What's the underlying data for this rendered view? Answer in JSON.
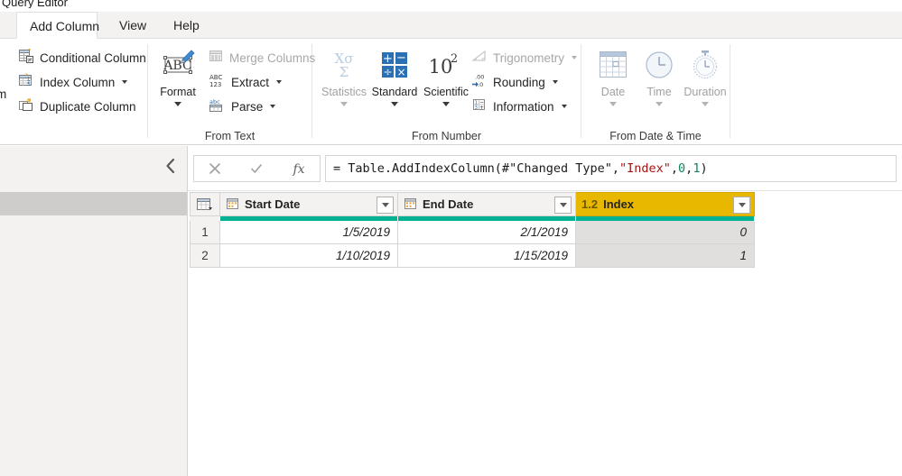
{
  "window": {
    "title": "Query Editor"
  },
  "tabs": [
    {
      "label": "Add Column",
      "active": true
    },
    {
      "label": "View",
      "active": false
    },
    {
      "label": "Help",
      "active": false
    }
  ],
  "ribbon": {
    "clipped_left_fragment": "m",
    "groups": [
      {
        "name": "general",
        "label": "",
        "items": [
          {
            "label": "Conditional Column",
            "icon": "conditional-column-icon",
            "enabled": true,
            "has_caret": false
          },
          {
            "label": "Index Column",
            "icon": "index-column-icon",
            "enabled": true,
            "has_caret": true
          },
          {
            "label": "Duplicate Column",
            "icon": "duplicate-column-icon",
            "enabled": true,
            "has_caret": false
          }
        ]
      },
      {
        "name": "from-text",
        "label": "From Text",
        "big_items": [
          {
            "label": "Format",
            "icon": "format-abc-pencil-icon",
            "enabled": true,
            "has_caret": true
          }
        ],
        "items": [
          {
            "label": "Merge Columns",
            "icon": "merge-columns-icon",
            "enabled": false,
            "has_caret": false
          },
          {
            "label": "Extract",
            "icon": "extract-abc123-icon",
            "enabled": true,
            "has_caret": true
          },
          {
            "label": "Parse",
            "icon": "parse-icon",
            "enabled": true,
            "has_caret": true
          }
        ]
      },
      {
        "name": "from-number",
        "label": "From Number",
        "big_items": [
          {
            "label": "Statistics",
            "icon": "statistics-sigma-icon",
            "enabled": false,
            "has_caret": true
          },
          {
            "label": "Standard",
            "icon": "standard-operators-icon",
            "enabled": true,
            "has_caret": true
          },
          {
            "label": "Scientific",
            "icon": "scientific-ten-squared-icon",
            "enabled": true,
            "has_caret": true
          }
        ],
        "items": [
          {
            "label": "Trigonometry",
            "icon": "trigonometry-icon",
            "enabled": false,
            "has_caret": true
          },
          {
            "label": "Rounding",
            "icon": "rounding-icon",
            "enabled": true,
            "has_caret": true
          },
          {
            "label": "Information",
            "icon": "information-icon",
            "enabled": true,
            "has_caret": true
          }
        ]
      },
      {
        "name": "from-date-time",
        "label": "From Date & Time",
        "big_items": [
          {
            "label": "Date",
            "icon": "calendar-icon",
            "enabled": false,
            "has_caret": true
          },
          {
            "label": "Time",
            "icon": "clock-icon",
            "enabled": false,
            "has_caret": true
          },
          {
            "label": "Duration",
            "icon": "stopwatch-icon",
            "enabled": false,
            "has_caret": true
          }
        ]
      }
    ]
  },
  "queries_pane": {
    "collapse_icon": "chevron-left-icon",
    "selected_item_label": ""
  },
  "formula_bar": {
    "cancel_icon": "cancel-x-icon",
    "accept_icon": "accept-check-icon",
    "fx_icon": "fx-icon",
    "formula_prefix": "= Table.AddIndexColumn(#\"Changed Type\", ",
    "formula_string": "\"Index\"",
    "formula_mid": ", ",
    "formula_num1": "0",
    "formula_comma": ", ",
    "formula_num2": "1",
    "formula_suffix": ")",
    "formula_full": "= Table.AddIndexColumn(#\"Changed Type\", \"Index\", 0, 1)"
  },
  "grid": {
    "corner_icon": "select-all-table-icon",
    "columns": [
      {
        "name": "Start Date",
        "type_icon": "date-type-icon",
        "type_glyph": "",
        "selected": false,
        "quality": "teal"
      },
      {
        "name": "End Date",
        "type_icon": "date-type-icon",
        "type_glyph": "",
        "selected": false,
        "quality": "teal"
      },
      {
        "name": "Index",
        "type_icon": "decimal-number-type-icon",
        "type_glyph": "1.2",
        "selected": true,
        "quality": "teal"
      }
    ],
    "rows": [
      {
        "num": "1",
        "cells": [
          "1/5/2019",
          "2/1/2019",
          "0"
        ]
      },
      {
        "num": "2",
        "cells": [
          "1/10/2019",
          "1/15/2019",
          "1"
        ]
      }
    ]
  },
  "colors": {
    "selected_column_header": "#e8b800",
    "quality_bar_good": "#00b294",
    "ribbon_bg": "#ffffff",
    "tabstrip_bg": "#f3f2f1",
    "pane_bg": "#f3f2f1",
    "selected_query_item": "#cfcdcb",
    "formula_string_token": "#a31515",
    "formula_number_token": "#09885a"
  }
}
